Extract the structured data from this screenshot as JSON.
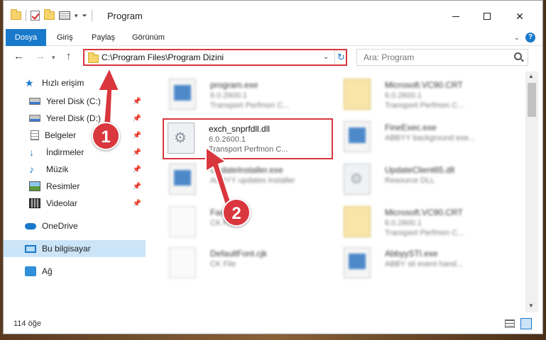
{
  "window": {
    "title": "Program"
  },
  "ribbon": {
    "tabs": [
      "Dosya",
      "Giriş",
      "Paylaş",
      "Görünüm"
    ]
  },
  "address": {
    "path": "C:\\Program Files\\Program Dizini"
  },
  "search": {
    "placeholder": "Ara: Program"
  },
  "sidebar": {
    "items": [
      {
        "label": "Hızlı erişim",
        "icon": "star-icon",
        "pinned": false
      },
      {
        "label": "Yerel Disk (C:)",
        "icon": "disk-icon",
        "pinned": true
      },
      {
        "label": "Yerel Disk (D:)",
        "icon": "disk-icon",
        "pinned": true
      },
      {
        "label": "Belgeler",
        "icon": "document-icon",
        "pinned": true
      },
      {
        "label": "İndirmeler",
        "icon": "download-icon",
        "pinned": true
      },
      {
        "label": "Müzik",
        "icon": "music-icon",
        "pinned": true
      },
      {
        "label": "Resimler",
        "icon": "pictures-icon",
        "pinned": true
      },
      {
        "label": "Videolar",
        "icon": "video-icon",
        "pinned": true
      },
      {
        "label": "OneDrive",
        "icon": "cloud-icon",
        "pinned": false
      },
      {
        "label": "Bu bilgisayar",
        "icon": "computer-icon",
        "pinned": false
      },
      {
        "label": "Ağ",
        "icon": "network-icon",
        "pinned": false
      }
    ]
  },
  "files": [
    {
      "name": "program.exe",
      "version": "6.0.2600.1",
      "desc": "Transport Perfmon C...",
      "icon": "exe-icon"
    },
    {
      "name": "Microsoft.VC90.CRT",
      "version": "6.0.2600.1",
      "desc": "Transport Perfmon C...",
      "icon": "folder-icon"
    },
    {
      "name": "exch_snprfdll.dll",
      "version": "6.0.2600.1",
      "desc": "Transport Perfmon C...",
      "icon": "gear-file-icon"
    },
    {
      "name": "FineExec.exe",
      "version": "ABBYY background exe...",
      "desc": "",
      "icon": "exe-icon"
    },
    {
      "name": "UpdateInstaller.exe",
      "version": "ABBYY updates installer",
      "desc": "",
      "icon": "exe-icon"
    },
    {
      "name": "UpdateClient65.dll",
      "version": "Resource DLL",
      "desc": "",
      "icon": "gear-file-icon"
    },
    {
      "name": "FastK...",
      "version": "CK File",
      "desc": "",
      "icon": "blank-file-icon"
    },
    {
      "name": "Microsoft.VC90.CRT",
      "version": "6.0.2600.1",
      "desc": "Transport Perfmon C...",
      "icon": "folder-icon"
    },
    {
      "name": "DefaultFont.cjk",
      "version": "CK File",
      "desc": "",
      "icon": "blank-file-icon"
    },
    {
      "name": "AbbyySTI.exe",
      "version": "ABBY sti event hand...",
      "desc": "",
      "icon": "exe-icon"
    }
  ],
  "status": {
    "item_count": "114 öğe"
  },
  "annotations": {
    "badge1": "1",
    "badge2": "2"
  },
  "colors": {
    "accent": "#1979ca",
    "highlight": "#d9363e"
  }
}
